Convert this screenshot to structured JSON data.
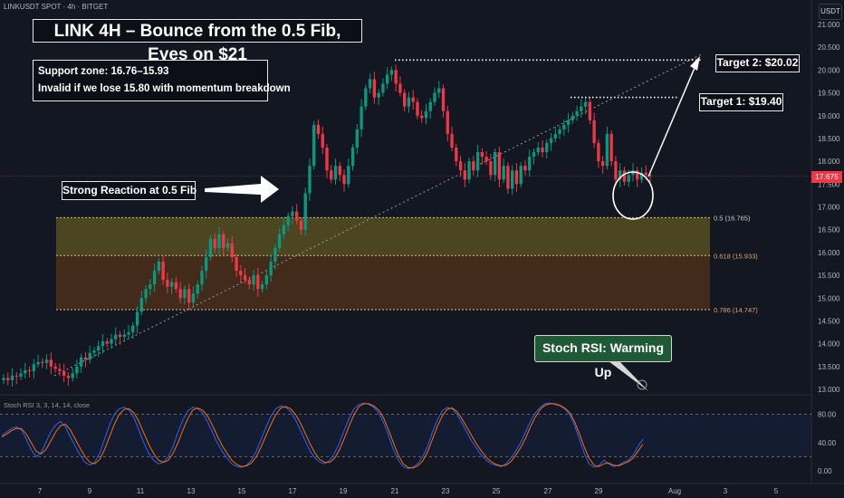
{
  "header": {
    "symbol_line": "LINKUSDT SPOT · 4h · BITGET",
    "currency": "USDT"
  },
  "annotations": {
    "title": "LINK 4H – Bounce from the 0.5 Fib, Eyes on $21",
    "support": "Support zone: 16.76–15.93",
    "invalid": "Invalid if we lose 15.80 with momentum breakdown",
    "reaction": "Strong Reaction at 0.5 Fib",
    "target1": "Target 1: $19.40",
    "target2": "Target 2: $20.02",
    "stoch_callout": "Stoch RSI: Warming Up"
  },
  "colors": {
    "up": "#089981",
    "down": "#f23645",
    "background": "#131722",
    "stoch_k": "#2962ff",
    "stoch_d": "#ff6d00",
    "zone": "#b8a33a"
  },
  "chart_data": {
    "type": "candlestick",
    "timeframe": "4h",
    "ylim": [
      13.0,
      21.0
    ],
    "y_ticks": [
      "13.000",
      "13.500",
      "14.000",
      "14.500",
      "15.000",
      "15.500",
      "16.000",
      "16.500",
      "17.000",
      "17.500",
      "18.000",
      "18.500",
      "19.000",
      "19.500",
      "20.000",
      "20.500",
      "21.000"
    ],
    "x_tick_labels": [
      "7",
      "9",
      "11",
      "13",
      "15",
      "17",
      "19",
      "21",
      "23",
      "25",
      "27",
      "29",
      "Aug",
      "3",
      "5"
    ],
    "last_price": "17.675",
    "fib_levels": [
      {
        "label": "0.5 (16.765)",
        "value": 16.765
      },
      {
        "label": "0.618 (15.933)",
        "value": 15.933
      },
      {
        "label": "0.786 (14.747)",
        "value": 14.747
      }
    ],
    "targets": [
      19.4,
      20.02
    ],
    "closes": [
      13.25,
      13.2,
      13.3,
      13.28,
      13.35,
      13.42,
      13.4,
      13.55,
      13.6,
      13.58,
      13.65,
      13.5,
      13.45,
      13.4,
      13.3,
      13.25,
      13.35,
      13.5,
      13.7,
      13.65,
      13.8,
      13.85,
      13.95,
      14.05,
      14.0,
      14.1,
      14.2,
      14.15,
      14.2,
      14.25,
      14.4,
      14.7,
      15.0,
      15.2,
      15.3,
      15.6,
      15.8,
      15.4,
      15.25,
      15.35,
      15.2,
      15.0,
      15.2,
      14.9,
      15.1,
      15.3,
      15.6,
      15.9,
      16.3,
      16.1,
      16.4,
      16.1,
      16.2,
      15.9,
      15.6,
      15.5,
      15.4,
      15.3,
      15.5,
      15.2,
      15.3,
      15.5,
      15.8,
      16.1,
      16.4,
      16.6,
      16.8,
      16.9,
      16.7,
      16.5,
      17.3,
      17.9,
      18.8,
      18.6,
      18.3,
      17.8,
      17.6,
      17.9,
      17.7,
      17.5,
      17.9,
      18.3,
      18.7,
      19.2,
      19.6,
      19.8,
      19.4,
      19.5,
      19.7,
      19.9,
      20.0,
      19.7,
      19.5,
      19.2,
      19.4,
      19.3,
      19.0,
      18.95,
      19.1,
      19.3,
      19.5,
      19.6,
      19.1,
      18.6,
      18.3,
      18.0,
      17.8,
      17.6,
      18.0,
      17.8,
      18.2,
      18.1,
      18.0,
      17.7,
      18.2,
      17.6,
      17.9,
      17.4,
      17.8,
      17.5,
      17.9,
      17.8,
      18.1,
      18.2,
      18.3,
      18.2,
      18.4,
      18.5,
      18.6,
      18.7,
      18.8,
      18.9,
      19.0,
      19.1,
      19.2,
      19.3,
      18.9,
      18.4,
      18.0,
      17.9,
      18.6,
      18.0,
      17.6,
      17.8,
      17.55,
      17.7,
      17.8,
      17.6,
      17.75,
      17.7,
      17.68
    ],
    "stoch_rsi": {
      "label": "Stoch RSI 3, 3, 14, 14, close",
      "ylim": [
        0,
        100
      ],
      "levels": [
        80,
        20
      ],
      "y_ticks": [
        "80.00",
        "40.00",
        "0.00"
      ],
      "k": [
        50,
        55,
        60,
        62,
        58,
        45,
        30,
        20,
        25,
        40,
        55,
        65,
        70,
        62,
        48,
        35,
        22,
        12,
        8,
        12,
        25,
        45,
        65,
        80,
        88,
        90,
        86,
        75,
        58,
        40,
        25,
        15,
        10,
        12,
        20,
        35,
        55,
        72,
        85,
        90,
        88,
        82,
        70,
        55,
        40,
        28,
        18,
        10,
        6,
        5,
        8,
        15,
        28,
        45,
        62,
        78,
        88,
        92,
        90,
        84,
        72,
        58,
        42,
        28,
        18,
        12,
        10,
        15,
        25,
        40,
        58,
        75,
        88,
        94,
        96,
        94,
        90,
        82,
        68,
        50,
        30,
        15,
        6,
        3,
        5,
        10,
        20,
        35,
        55,
        72,
        85,
        90,
        88,
        80,
        68,
        55,
        42,
        32,
        22,
        15,
        10,
        8,
        6,
        10,
        18,
        28,
        40,
        55,
        70,
        82,
        90,
        95,
        96,
        94,
        92,
        88,
        80,
        65,
        45,
        25,
        10,
        5,
        8,
        15,
        10,
        6,
        8,
        12,
        15,
        22,
        35,
        45
      ],
      "d": [
        48,
        52,
        57,
        60,
        60,
        52,
        40,
        28,
        24,
        30,
        42,
        55,
        64,
        66,
        58,
        45,
        32,
        20,
        12,
        10,
        16,
        30,
        48,
        66,
        80,
        87,
        88,
        82,
        70,
        54,
        38,
        25,
        15,
        12,
        15,
        25,
        40,
        58,
        74,
        86,
        89,
        86,
        78,
        65,
        50,
        36,
        25,
        15,
        9,
        6,
        7,
        11,
        20,
        34,
        50,
        66,
        80,
        89,
        91,
        88,
        80,
        68,
        53,
        38,
        25,
        16,
        12,
        12,
        18,
        30,
        46,
        64,
        80,
        91,
        95,
        95,
        92,
        86,
        75,
        58,
        40,
        22,
        10,
        5,
        4,
        7,
        14,
        27,
        45,
        63,
        78,
        87,
        89,
        84,
        74,
        62,
        50,
        38,
        28,
        19,
        13,
        9,
        7,
        8,
        13,
        22,
        33,
        46,
        62,
        76,
        87,
        93,
        95,
        95,
        93,
        89,
        83,
        70,
        53,
        34,
        18,
        8,
        6,
        10,
        11,
        8,
        7,
        10,
        13,
        18,
        28,
        38
      ]
    }
  }
}
